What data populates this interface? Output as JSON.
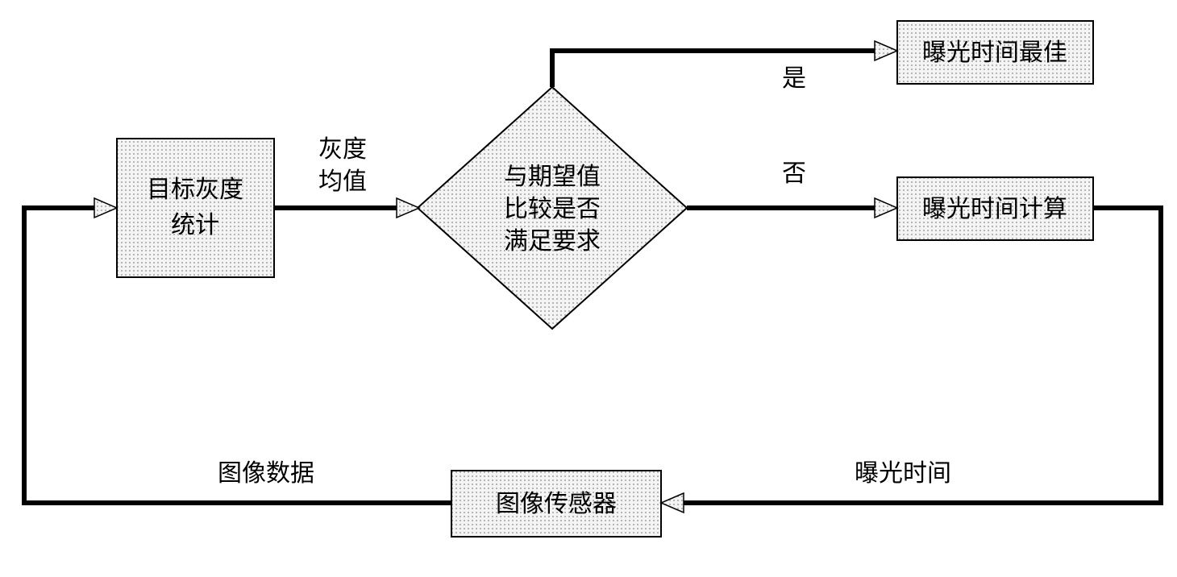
{
  "nodes": {
    "grayscale_statistics": {
      "line1": "目标灰度",
      "line2": "统计"
    },
    "decision": {
      "line1": "与期望值",
      "line2": "比较是否",
      "line3": "满足要求"
    },
    "exposure_best": "曝光时间最佳",
    "exposure_calc": "曝光时间计算",
    "image_sensor": "图像传感器"
  },
  "edges": {
    "gray_mean": {
      "line1": "灰度",
      "line2": "均值"
    },
    "yes": "是",
    "no": "否",
    "image_data": "图像数据",
    "exposure_time": "曝光时间"
  }
}
